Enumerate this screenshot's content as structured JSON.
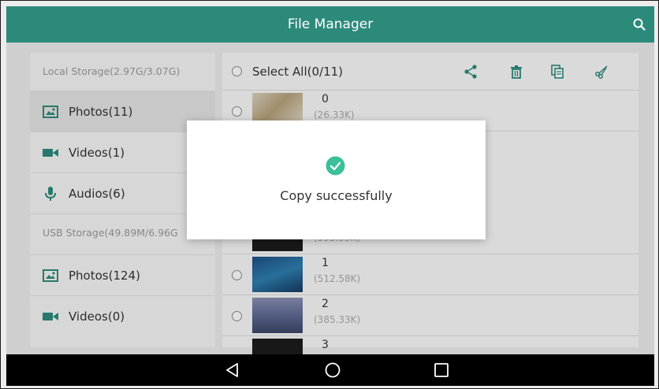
{
  "header": {
    "title": "File Manager",
    "search_icon": "search-icon"
  },
  "sidebar": {
    "local_header": "Local Storage(2.97G/3.07G)",
    "local_items": [
      {
        "label": "Photos(11)",
        "icon": "image-icon",
        "selected": true
      },
      {
        "label": "Videos(1)",
        "icon": "video-camera-icon",
        "selected": false
      },
      {
        "label": "Audios(6)",
        "icon": "microphone-icon",
        "selected": false
      }
    ],
    "usb_header": "USB Storage(49.89M/6.96G",
    "usb_items": [
      {
        "label": "Photos(124)",
        "icon": "image-icon"
      },
      {
        "label": "Videos(0)",
        "icon": "video-camera-icon"
      }
    ]
  },
  "toolbar": {
    "select_all_label": "Select All(0/11)",
    "actions": [
      "share-icon",
      "delete-icon",
      "copy-icon",
      "cut-icon"
    ]
  },
  "files": [
    {
      "name": "0",
      "size": "(26.33K)"
    },
    {
      "name": "",
      "size": "(393.99K)"
    },
    {
      "name": "1",
      "size": "(512.58K)"
    },
    {
      "name": "2",
      "size": "(385.33K)"
    },
    {
      "name": "3",
      "size": ""
    }
  ],
  "dialog": {
    "message": "Copy successfully",
    "icon": "check-circle-icon"
  },
  "navigation": {
    "back": "back-icon",
    "home": "home-icon",
    "recents": "recents-icon"
  },
  "colors": {
    "accent": "#2c8a7b",
    "success": "#3cbf9a",
    "nav_background": "#000000"
  }
}
